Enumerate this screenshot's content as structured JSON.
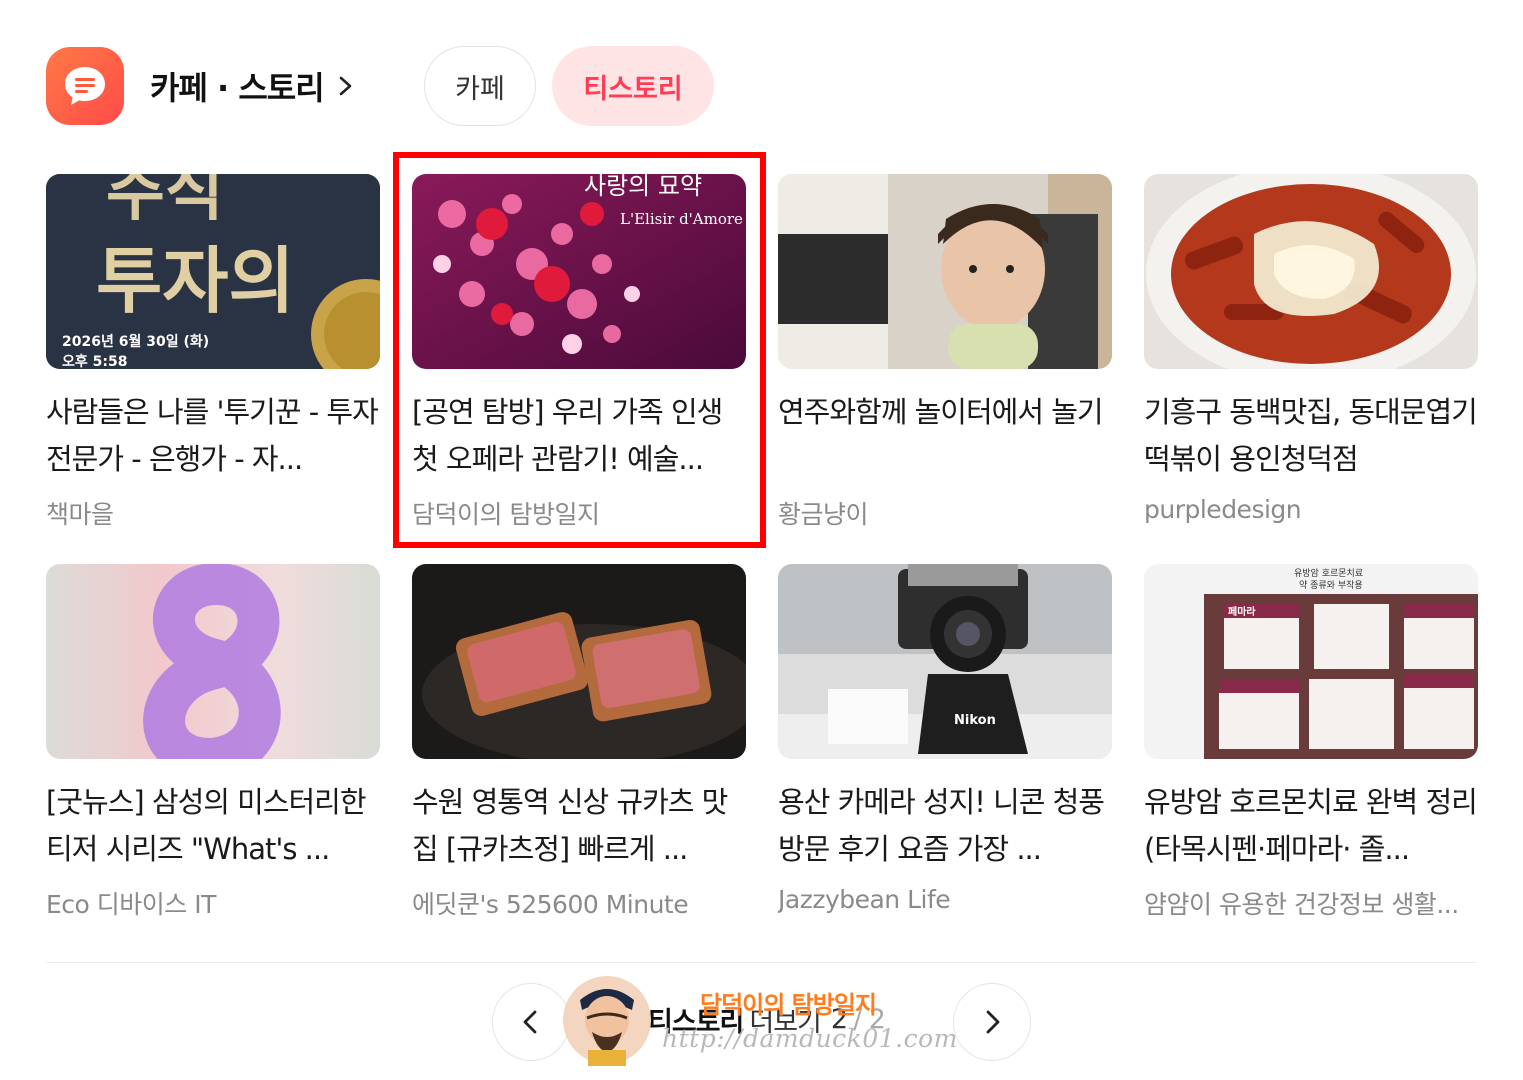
{
  "header": {
    "section_title": "카페 · 스토리",
    "icon": "chat-bubble-icon",
    "accent_color": "#ff4a4a",
    "tabs": [
      {
        "label": "카페",
        "active": false
      },
      {
        "label": "티스토리",
        "active": true
      }
    ]
  },
  "items": [
    {
      "title": "사람들은 나를 '투기꾼 - 투자 전문가 - 은행가 - 자...",
      "source": "책마을",
      "thumb_text_1": "투자의",
      "thumb_text_2": "2026년 6월 30일 (화)",
      "thumb_text_3": "오후 5:58"
    },
    {
      "title": "[공연 탐방] 우리 가족 인생 첫 오페라 관람기! 예술...",
      "source": "담덕이의 탐방일지",
      "thumb_text_1": "사랑의 묘약",
      "thumb_text_2": "L'Elisir d'Amore"
    },
    {
      "title": "연주와함께 놀이터에서 놀기",
      "source": "황금냥이"
    },
    {
      "title": "기흥구 동백맛집, 동대문엽기떡볶이 용인청덕점",
      "source": "purpledesign"
    },
    {
      "title": "[굿뉴스] 삼성의 미스터리한 티저 시리즈 \"What's ...",
      "source": "Eco 디바이스 IT"
    },
    {
      "title": "수원 영통역 신상 규카츠 맛집 [규카츠정] 빠르게 ...",
      "source": "에딧쿤's 525600 Minute"
    },
    {
      "title": "용산 카메라 성지! 니콘 청풍 방문 후기 요즘 가장 ...",
      "source": "Jazzybean Life",
      "thumb_text_1": "Nikon"
    },
    {
      "title": "유방암 호르몬치료 완벽 정리 (타목시펜·페마라· 졸...",
      "source": "얌얌이 유용한 건강정보 생활...",
      "thumb_text_1": "유방암 호르몬치료",
      "thumb_text_2": "약 종류와 부작용",
      "thumb_text_3": "페마라"
    }
  ],
  "pager": {
    "more_bold": "티스토리",
    "more_rest": "더보기",
    "current": "2",
    "total": "/ 2"
  },
  "watermark": {
    "title": "담덕이의 탐방일지",
    "url": "http://damduck01.com"
  }
}
